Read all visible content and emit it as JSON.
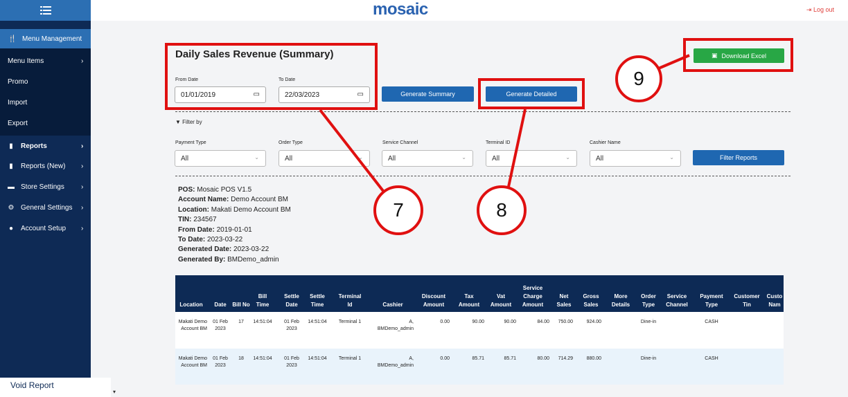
{
  "app": {
    "logo": "mosaic",
    "logout_label": "Log out"
  },
  "sidebar": {
    "active": {
      "label": "Menu Management"
    },
    "sub_items": [
      {
        "label": "Menu Items",
        "has_chevron": true
      },
      {
        "label": "Promo"
      },
      {
        "label": "Import"
      },
      {
        "label": "Export"
      }
    ],
    "items": [
      {
        "label": "Reports"
      },
      {
        "label": "Reports (New)"
      },
      {
        "label": "Store Settings"
      },
      {
        "label": "General Settings"
      },
      {
        "label": "Account Setup"
      }
    ],
    "bottom_label": "Void Report"
  },
  "report": {
    "title": "Daily Sales Revenue (Summary)",
    "from_label": "From Date",
    "from_value": "01/01/2019",
    "to_label": "To Date",
    "to_value": "22/03/2023",
    "generate_summary": "Generate Summary",
    "generate_detailed": "Generate Detailed",
    "download_excel": "Download Excel",
    "filter_by": "Filter by",
    "filter_reports": "Filter Reports",
    "filters": [
      {
        "label": "Payment Type",
        "value": "All"
      },
      {
        "label": "Order Type",
        "value": "All"
      },
      {
        "label": "Service Channel",
        "value": "All"
      },
      {
        "label": "Terminal ID",
        "value": "All"
      },
      {
        "label": "Cashier Name",
        "value": "All"
      }
    ]
  },
  "info": [
    {
      "k": "POS:",
      "v": "Mosaic POS V1.5"
    },
    {
      "k": "Account Name:",
      "v": "Demo Account BM"
    },
    {
      "k": "Location:",
      "v": "Makati Demo Account BM"
    },
    {
      "k": "TIN:",
      "v": "234567"
    },
    {
      "k": "From Date:",
      "v": "2019-01-01"
    },
    {
      "k": "To Date:",
      "v": "2023-03-22"
    },
    {
      "k": "Generated Date:",
      "v": "2023-03-22"
    },
    {
      "k": "Generated By:",
      "v": "BMDemo_admin"
    }
  ],
  "table": {
    "headers": [
      "Location",
      "Date",
      "Bill No",
      "Bill Time",
      "Settle Date",
      "Settle Time",
      "Terminal Id",
      "Cashier",
      "Discount Amount",
      "Tax Amount",
      "Vat Amount",
      "Service Charge Amount",
      "Net Sales",
      "Gross Sales",
      "More Details",
      "Order Type",
      "Service Channel",
      "Payment Type",
      "Customer Tin",
      "Custo Nam"
    ],
    "rows": [
      [
        "Makati Demo Account BM",
        "01 Feb 2023",
        "17",
        "14:51:04",
        "01 Feb 2023",
        "14:51:04",
        "Terminal 1",
        "A, BMDemo_admin",
        "0.00",
        "90.00",
        "90.00",
        "84.00",
        "750.00",
        "924.00",
        "",
        "Dine-in",
        "",
        "CASH",
        "",
        ""
      ],
      [
        "Makati Demo Account BM",
        "01 Feb 2023",
        "18",
        "14:51:04",
        "01 Feb 2023",
        "14:51:04",
        "Terminal 1",
        "A, BMDemo_admin",
        "0.00",
        "85.71",
        "85.71",
        "80.00",
        "714.29",
        "880.00",
        "",
        "Dine-in",
        "",
        "CASH",
        "",
        ""
      ]
    ]
  },
  "annotations": [
    "7",
    "8",
    "9"
  ],
  "colors": {
    "annotation": "#e01010",
    "primary": "#1f67b1",
    "success": "#28a745",
    "sidebar": "#0e2a55"
  }
}
